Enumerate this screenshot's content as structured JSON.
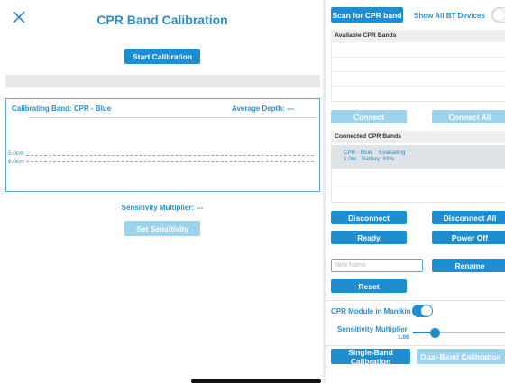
{
  "header": {
    "title": "CPR Band Calibration",
    "close_icon": "close-icon"
  },
  "calibration": {
    "start_label": "Start Calibration",
    "calibrating_band": "Calibrating Band: CPR - Blue",
    "average_depth": "Average Depth: ---",
    "marker_a": "5.0cm",
    "marker_b": "6.0cm",
    "sensitivity": "Sensitivity Multiplier: ---",
    "set_sensitivity_label": "Set Sensitivity"
  },
  "right_panel": {
    "scan_label": "Scan for CPR band",
    "show_all_label": "Show All BT Devices",
    "show_all_on": false,
    "available_header": "Available CPR Bands",
    "connect_label": "Connect",
    "connect_all_label": "Connect All",
    "connected_header": "Connected CPR Bands",
    "connected": [
      {
        "name": "CPR - Blue",
        "status": "Evaluating",
        "distance": "1.0m",
        "battery": "Battery: 83%"
      }
    ],
    "disconnect_label": "Disconnect",
    "disconnect_all_label": "Disconnect All",
    "ready_label": "Ready",
    "power_off_label": "Power Off",
    "name_placeholder": "New Name",
    "rename_label": "Rename",
    "reset_label": "Reset",
    "module_label": "CPR Module in Manikin",
    "module_on": true,
    "sensitivity_label": "Sensitivity Multiplier",
    "sensitivity_value": "1.00",
    "sensitivity_level": 0.24,
    "single_band_label": "Single-Band Calibration",
    "dual_band_label": "Dual-Band Calibration"
  },
  "colors": {
    "accent": "#1f8ed1",
    "accent_disabled": "#9dd3ec",
    "text_accent": "#2a8fc8"
  }
}
